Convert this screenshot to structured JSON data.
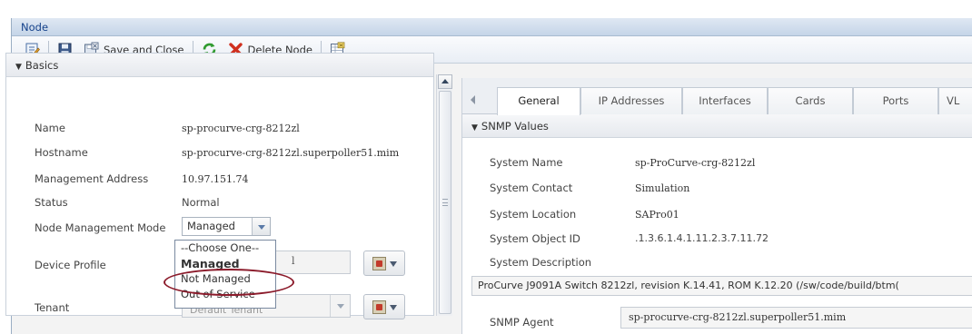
{
  "window": {
    "title": "Node"
  },
  "toolbar": {
    "save_close_label": "Save and Close",
    "delete_label": "Delete Node"
  },
  "basics": {
    "header": "Basics",
    "name_label": "Name",
    "name_value": "sp-procurve-crg-8212zl",
    "hostname_label": "Hostname",
    "hostname_value": "sp-procurve-crg-8212zl.superpoller51.mim",
    "mgmt_addr_label": "Management Address",
    "mgmt_addr_value": "10.97.151.74",
    "status_label": "Status",
    "status_value": "Normal",
    "mode_label": "Node Management Mode",
    "mode_value": "Managed",
    "device_profile_label": "Device Profile",
    "device_profile_value": "l",
    "tenant_label": "Tenant",
    "tenant_value": "Default Tenant"
  },
  "mode_dropdown": {
    "options": [
      "--Choose One--",
      "Managed",
      "Not Managed",
      "Out of Service"
    ],
    "selected": "Managed"
  },
  "tabs": [
    "General",
    "IP Addresses",
    "Interfaces",
    "Cards",
    "Ports",
    "VL"
  ],
  "snmp": {
    "header": "SNMP Values",
    "system_name_label": "System Name",
    "system_name_value": "sp-ProCurve-crg-8212zl",
    "system_contact_label": "System Contact",
    "system_contact_value": "Simulation",
    "system_location_label": "System Location",
    "system_location_value": "SAPro01",
    "system_object_id_label": "System Object ID",
    "system_object_id_value": ".1.3.6.1.4.1.11.2.3.7.11.72",
    "system_desc_label": "System Description",
    "system_desc_value": "ProCurve J9091A Switch 8212zl, revision K.14.41, ROM K.12.20 (/sw/code/build/btm(",
    "snmp_agent_label": "SNMP Agent",
    "snmp_agent_value": "sp-procurve-crg-8212zl.superpoller51.mim"
  },
  "colors": {
    "title_text": "#15428b",
    "highlight_ring": "#8b1a2a",
    "delete_x": "#d0301f",
    "refresh_green": "#2f9a2f"
  }
}
